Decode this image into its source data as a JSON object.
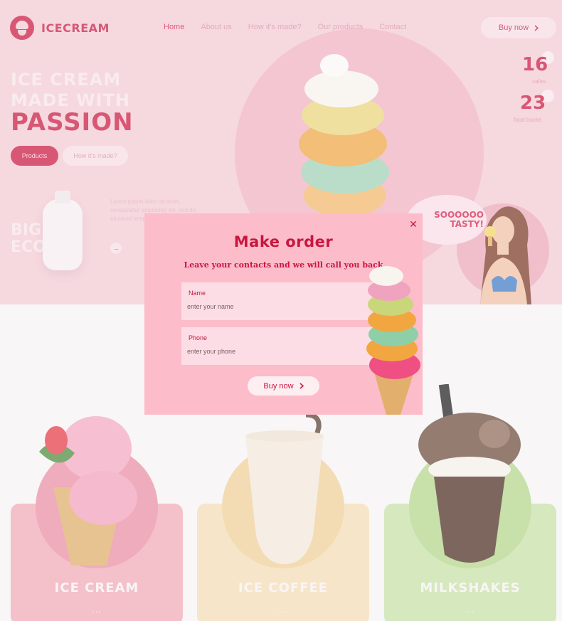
{
  "brand": {
    "name": "ICECREAM"
  },
  "nav": {
    "items": [
      {
        "label": "Home",
        "active": true
      },
      {
        "label": "About us"
      },
      {
        "label": "How it's made?"
      },
      {
        "label": "Our products"
      },
      {
        "label": "Contact"
      }
    ],
    "buy_label": "Buy now",
    "buy_icon": "chevron-right-icon"
  },
  "hero": {
    "headline_line1": "ICE CREAM",
    "headline_line2": "MADE WITH",
    "headline_line3": "PASSION",
    "products_label": "Products",
    "how_label": "How it's made?",
    "promo_line1": "BIG",
    "promo_line2": "ECO",
    "lorem": "Lorem ipsum dolor sit amet, consectetur adipiscing elit, sed do eiusmod tempor incididunt",
    "speech_line1": "SOOOOOO",
    "speech_line2": "TASTY!"
  },
  "stats": [
    {
      "value": "16",
      "label": "cafes"
    },
    {
      "value": "23",
      "label": "food trucks"
    }
  ],
  "products": [
    {
      "title": "ICE CREAM",
      "more": "...",
      "card_color": "#f0a8b6",
      "circle_color": "#e98ca2"
    },
    {
      "title": "ICE COFFEE",
      "more": "...",
      "card_color": "#f4dcb4",
      "circle_color": "#efcf98"
    },
    {
      "title": "MILKSHAKES",
      "more": "...",
      "card_color": "#c6e0a4",
      "circle_color": "#b3d58a"
    }
  ],
  "modal": {
    "title": "Make order",
    "subtitle": "Leave your contacts and we will call you back",
    "name_label": "Name",
    "name_placeholder": "enter your name",
    "phone_label": "Phone",
    "phone_placeholder": "enter your phone",
    "buy_label": "Buy now",
    "close_icon": "close-icon"
  },
  "colors": {
    "accent": "#c8173f",
    "hero_bg": "#f3c9d3",
    "modal_bg": "#fcbcca",
    "field_bg": "#fcdde5"
  }
}
